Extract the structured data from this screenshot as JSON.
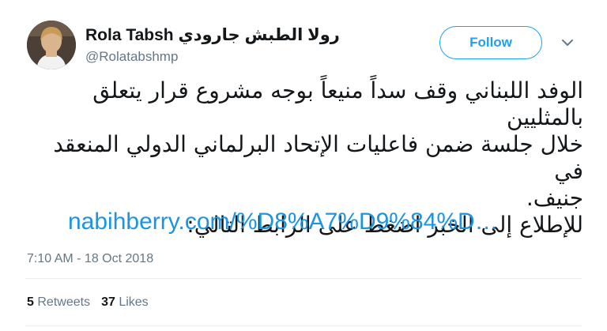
{
  "user": {
    "display_name": "Rola Tabsh روﻻ الطبش جارودي",
    "handle": "@Rolatabshmp",
    "avatar": "profile-photo"
  },
  "actions": {
    "follow_label": "Follow",
    "menu_icon": "chevron-down-icon"
  },
  "tweet": {
    "line_1": "الوفد اللبناني وقف سداً منيعاً بوجه مشروع قرار يتعلق بالمثليين",
    "line_2": "خلال جلسة ضمن فاعليات الإتحاد البرلماني الدولي المنعقد في",
    "line_3": "جنيف.",
    "line_4": "للإطلاع إلى الخبر اضغط على الرابط التالي:",
    "link": "nabihberry.com/%D8%A7%D9%84%D…",
    "timestamp": "7:10 AM - 18 Oct 2018"
  },
  "stats": {
    "retweets_count": "5",
    "retweets_label": "Retweets",
    "likes_count": "37",
    "likes_label": "Likes"
  },
  "colors": {
    "accent": "#1da1f2",
    "link": "#1b95e0",
    "muted": "#657786",
    "text": "#14171a",
    "divider": "#e6ecf0"
  }
}
